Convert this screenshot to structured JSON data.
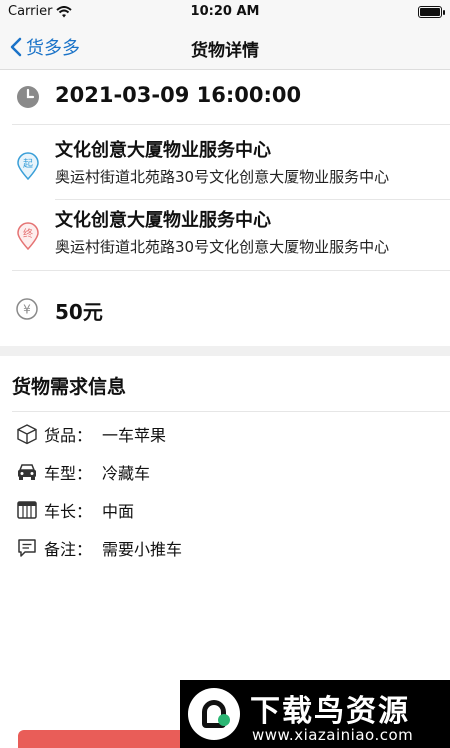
{
  "status_bar": {
    "carrier": "Carrier",
    "time": "10:20 AM"
  },
  "nav": {
    "back_label": "货多多",
    "title": "货物详情"
  },
  "cargo": {
    "datetime": "2021-03-09 16:00:00",
    "origin": {
      "badge": "起",
      "name": "文化创意大厦物业服务中心",
      "address": "奥运村街道北苑路30号文化创意大厦物业服务中心"
    },
    "destination": {
      "badge": "终",
      "name": "文化创意大厦物业服务中心",
      "address": "奥运村街道北苑路30号文化创意大厦物业服务中心"
    },
    "price_symbol": "¥",
    "price": "50元"
  },
  "requirements": {
    "title": "货物需求信息",
    "items": [
      {
        "icon": "box-icon",
        "label": "货品",
        "sep": "：",
        "value": "一车苹果"
      },
      {
        "icon": "truck-icon",
        "label": "车型",
        "sep": "：",
        "value": "冷藏车"
      },
      {
        "icon": "truck-bed-icon",
        "label": "车长",
        "sep": "：",
        "value": "中面"
      },
      {
        "icon": "note-icon",
        "label": "备注",
        "sep": "：",
        "value": "需要小推车"
      }
    ]
  },
  "watermark": {
    "title": "下载鸟资源",
    "url": "www.xiazainiao.com"
  },
  "colors": {
    "accent": "#1a73c8",
    "origin": "#3a9fd8",
    "destination": "#e57373",
    "button_left": "#e95d58",
    "button_right": "#3a7de0"
  }
}
